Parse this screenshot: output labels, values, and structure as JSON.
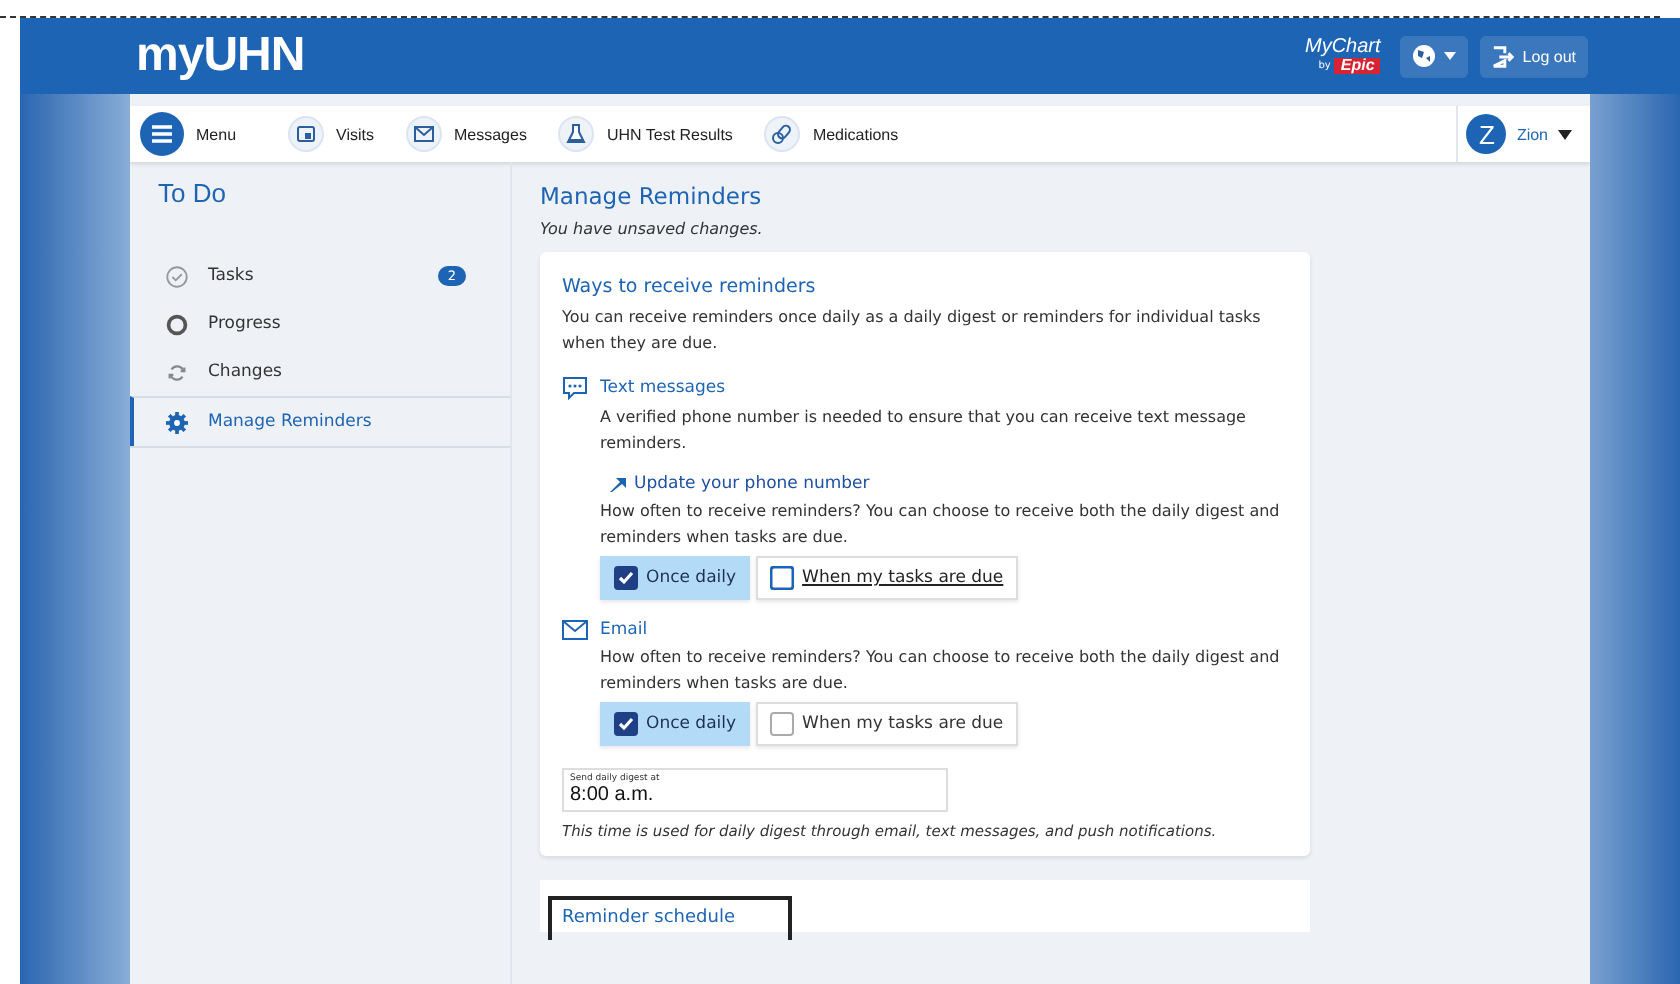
{
  "header": {
    "logo": "myUHN",
    "partner": {
      "name": "MyChart",
      "by": "by",
      "brand": "Epic"
    },
    "logout": "Log out"
  },
  "nav": {
    "menu": "Menu",
    "items": [
      {
        "label": "Visits",
        "kind": "calendar"
      },
      {
        "label": "Messages",
        "kind": "mail"
      },
      {
        "label": "UHN Test Results",
        "kind": "flask"
      },
      {
        "label": "Medications",
        "kind": "pills"
      }
    ],
    "user": {
      "initial": "Z",
      "name": "Zion"
    }
  },
  "sidebar": {
    "title": "To Do",
    "items": [
      {
        "label": "Tasks",
        "kind": "check",
        "badge": "2",
        "selected": false
      },
      {
        "label": "Progress",
        "kind": "ring",
        "selected": false
      },
      {
        "label": "Changes",
        "kind": "cycle",
        "selected": false
      },
      {
        "label": "Manage Reminders",
        "kind": "gear",
        "selected": true
      }
    ]
  },
  "main": {
    "title": "Manage Reminders",
    "notice": "You have unsaved changes.",
    "card": {
      "title": "Ways to receive reminders",
      "intro": "You can receive reminders once daily as a daily digest or reminders for individual tasks when they are due.",
      "channels": [
        {
          "kind": "sms",
          "name": "Text messages",
          "description": "A verified phone number is needed to ensure that you can receive text message reminders.",
          "link": "Update your phone number",
          "question": "How often to receive reminders? You can choose to receive both the daily digest and reminders when tasks are due.",
          "options": [
            {
              "label": "Once daily",
              "checked": true,
              "focused": false
            },
            {
              "label": "When my tasks are due",
              "checked": false,
              "focused": true
            }
          ]
        },
        {
          "kind": "email",
          "name": "Email",
          "question": "How often to receive reminders? You can choose to receive both the daily digest and reminders when tasks are due.",
          "options": [
            {
              "label": "Once daily",
              "checked": true,
              "focused": false
            },
            {
              "label": "When my tasks are due",
              "checked": false,
              "focused": false
            }
          ]
        }
      ],
      "time": {
        "label": "Send daily digest at",
        "value": "8:00 a.m."
      },
      "note": "This time is used for daily digest through email, text messages, and push notifications."
    },
    "next_card": {
      "title": "Reminder schedule"
    }
  }
}
